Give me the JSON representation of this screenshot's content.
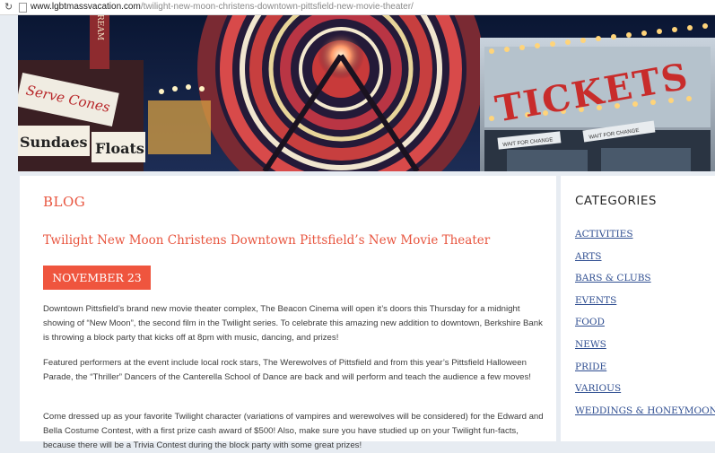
{
  "browser": {
    "url_domain": "www.lgbtmassvacation.com",
    "url_path": "/twilight-new-moon-christens-downtown-pittsfield-new-movie-theater/"
  },
  "banner": {
    "sign_left_top": "Serve Cones",
    "sign_left_bottom_1": "Sundaes",
    "sign_left_bottom_2": "Floats",
    "sign_vertical": "CREAM",
    "sign_right": "TICKETS",
    "window_label_1": "WAIT FOR CHANGE",
    "window_label_2": "WAIT FOR CHANGE"
  },
  "blog": {
    "section_title": "BLOG",
    "post_title": "Twilight New Moon Christens Downtown Pittsfield’s New Movie Theater",
    "date": "NOVEMBER 23",
    "paragraph_1": "Downtown Pittsfield’s brand new movie theater complex, The Beacon Cinema will open it’s doors this Thursday for a midnight showing of “New Moon”, the second film in the Twilight series. To celebrate this amazing new addition to downtown, Berkshire Bank is throwing a block party that kicks off at 8pm with music, dancing, and prizes!",
    "paragraph_2": "Featured performers at the event include local rock stars, The Werewolves of Pittsfield and from this year’s Pittsfield Halloween Parade, the “Thriller” Dancers of the Canterella School of Dance are back and will perform and teach the audience a few moves!",
    "paragraph_3": "Come dressed up as your favorite Twilight character (variations of vampires and werewolves will be considered) for the Edward and Bella Costume Contest, with a first prize cash award of $500! Also, make sure you have studied up on your Twilight fun-facts, because there will be a Trivia Contest during the block party with some great prizes!"
  },
  "sidebar": {
    "title": "CATEGORIES",
    "items": [
      {
        "label": "ACTIVITIES"
      },
      {
        "label": "ARTS"
      },
      {
        "label": "BARS & CLUBS"
      },
      {
        "label": "EVENTS"
      },
      {
        "label": "FOOD"
      },
      {
        "label": "NEWS"
      },
      {
        "label": "PRIDE"
      },
      {
        "label": "VARIOUS"
      },
      {
        "label": "WEDDINGS & HONEYMOONS"
      }
    ]
  },
  "colors": {
    "accent": "#ef553e",
    "link": "#2f4e91",
    "page_bg": "#e7ecf2"
  }
}
